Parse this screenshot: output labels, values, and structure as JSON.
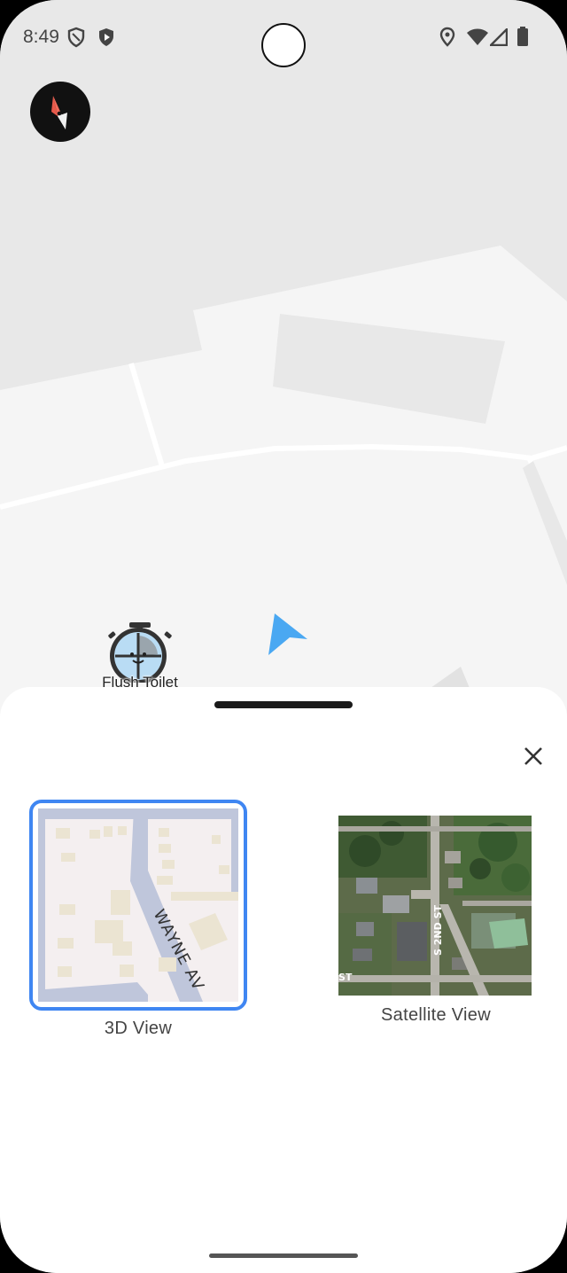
{
  "status_bar": {
    "time": "8:49",
    "icons": [
      "shield-outline-icon",
      "shield-play-icon",
      "location-pin-icon",
      "wifi-icon",
      "signal-icon",
      "battery-icon"
    ]
  },
  "map": {
    "poi_label": "Flush Toilet",
    "colors": {
      "background": "#e8e8e8",
      "land": "#f5f5f5",
      "road": "#ffffff",
      "arrow": "#4aa8f2"
    }
  },
  "sheet": {
    "close_icon": "close-icon",
    "options": [
      {
        "label": "3D View",
        "selected": true,
        "street_label": "WAYNE AV"
      },
      {
        "label": "Satellite View",
        "selected": false,
        "street_label": "S 2ND ST",
        "street_label_2": "ST"
      }
    ],
    "accent_color": "#3f86f2"
  }
}
